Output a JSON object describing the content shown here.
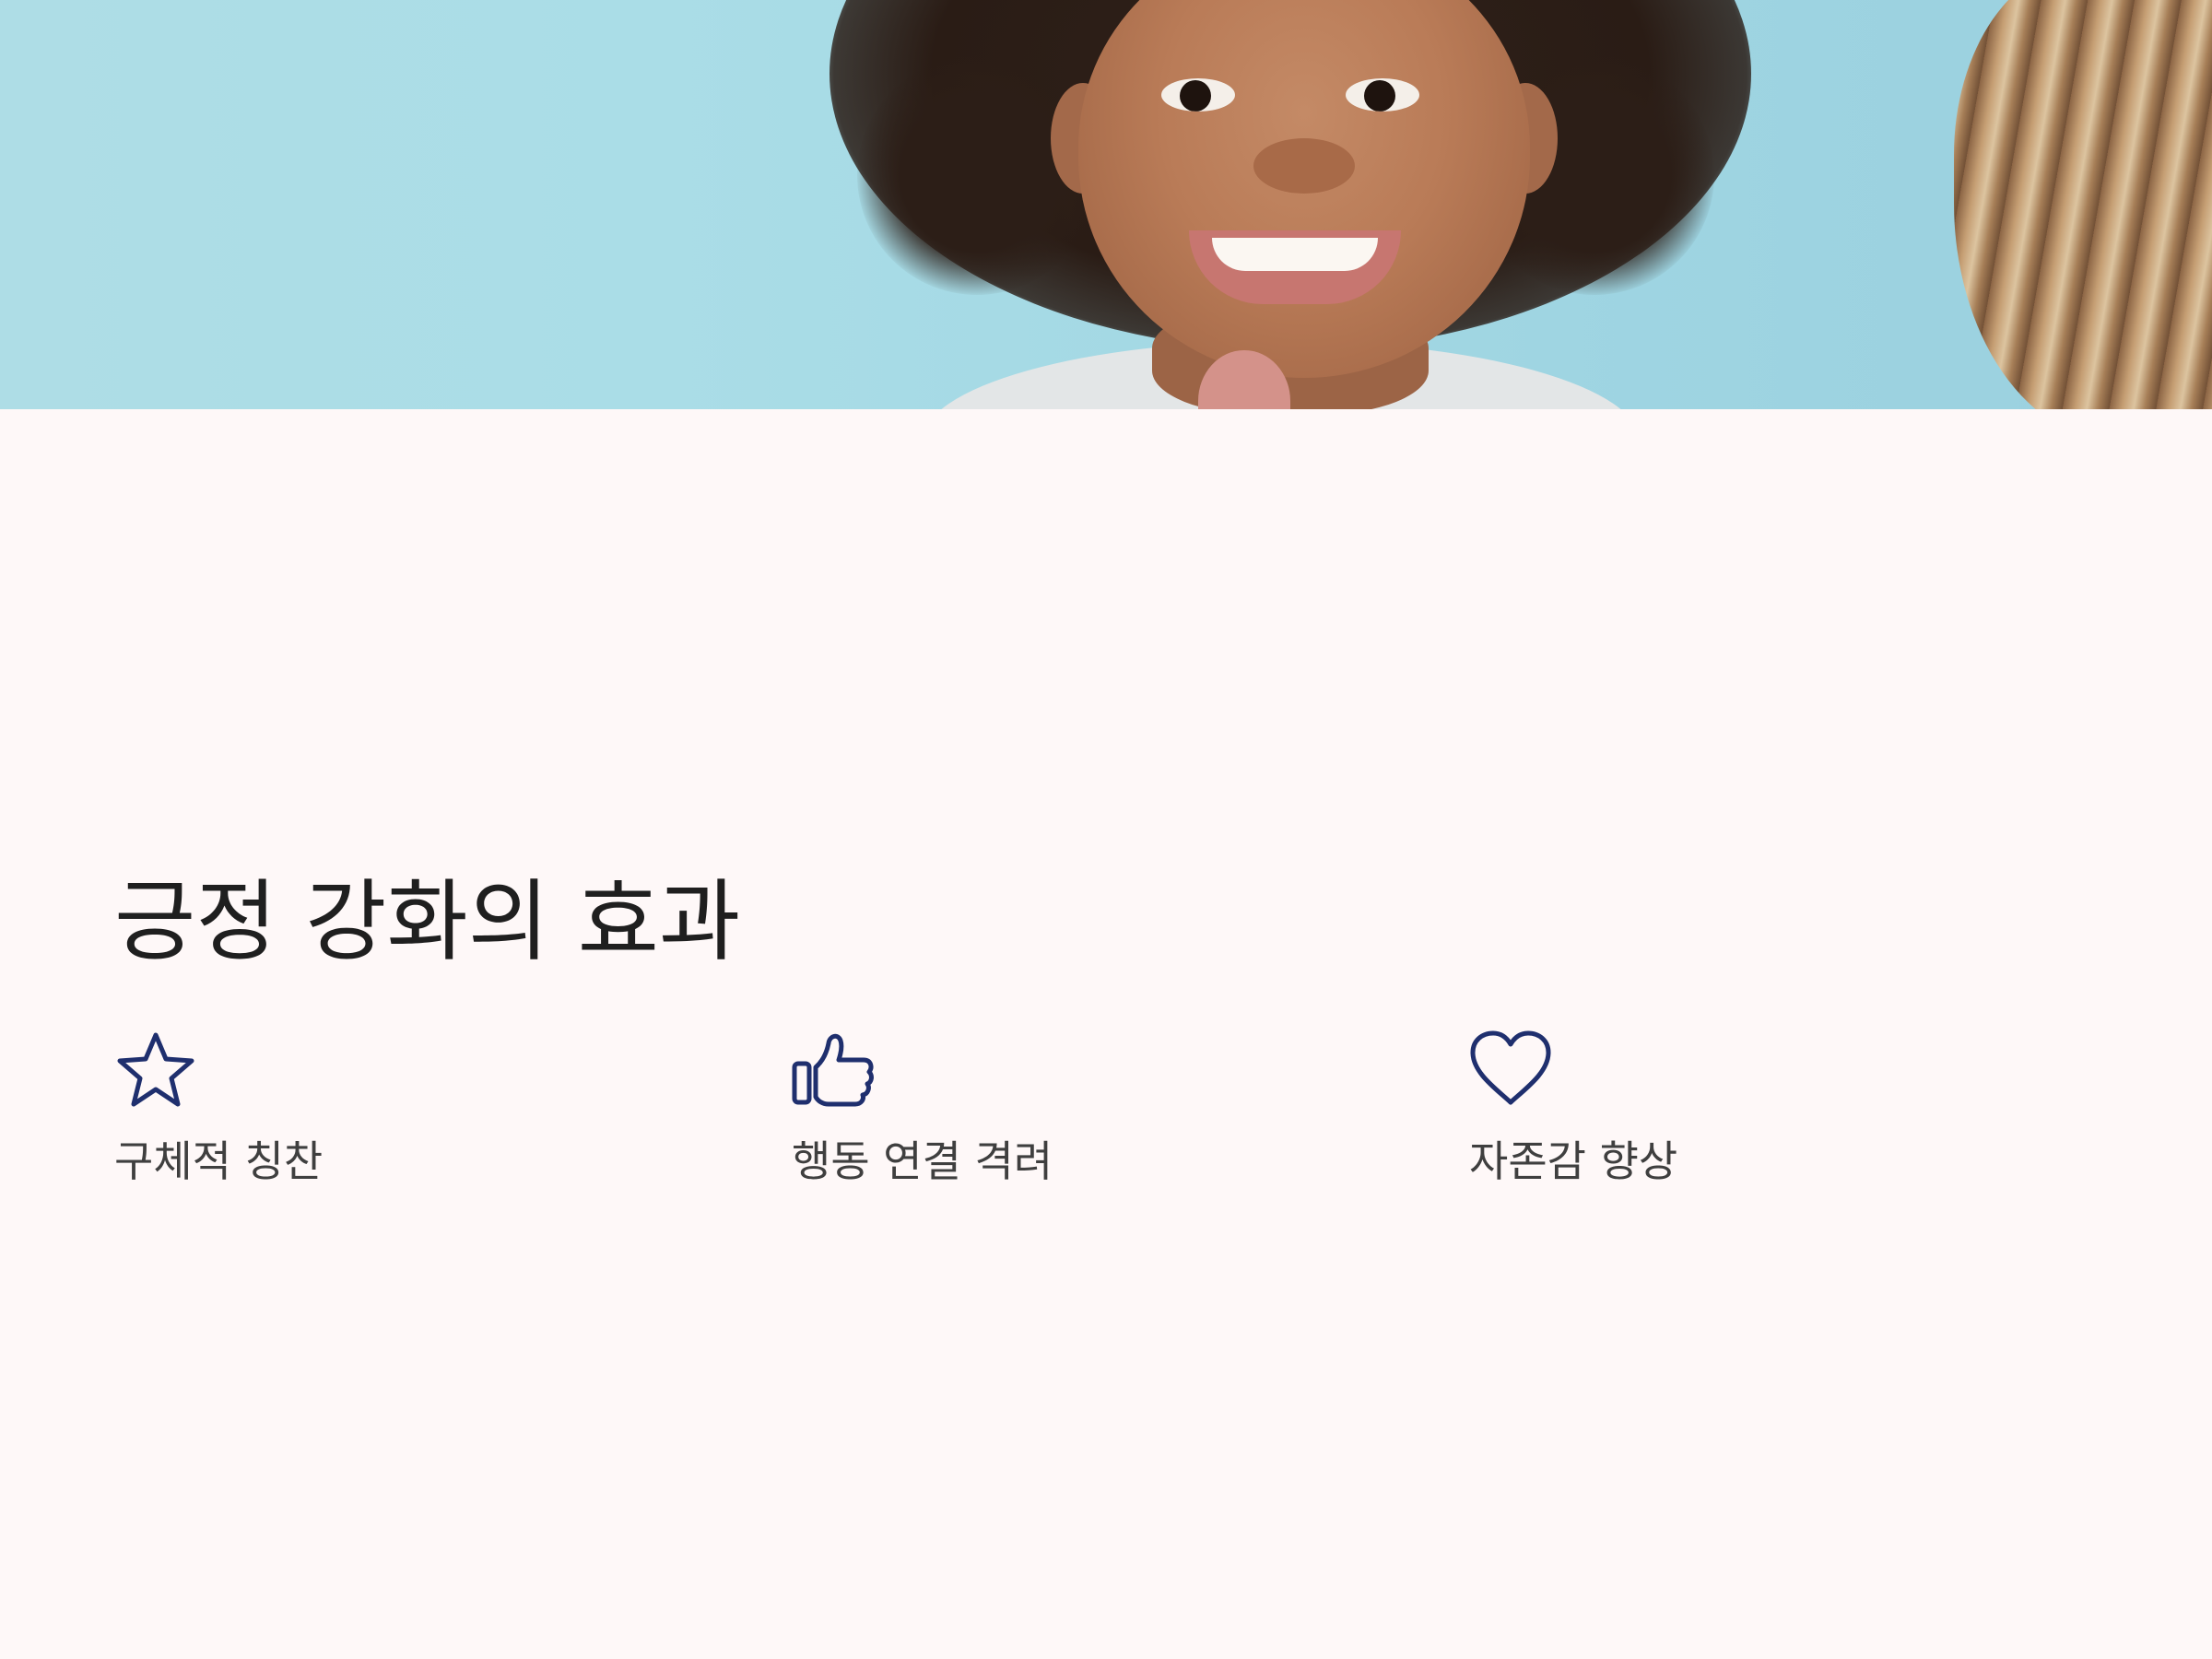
{
  "hero": {
    "image": "smiling-child-photo"
  },
  "section": {
    "title": "긍정 강화의 효과",
    "features": [
      {
        "icon": "star-icon",
        "label": "구체적 칭찬"
      },
      {
        "icon": "thumbs-up-icon",
        "label": "행동 연결 격려"
      },
      {
        "icon": "heart-icon",
        "label": "자존감 향상"
      }
    ]
  },
  "colors": {
    "background": "#fef8f8",
    "icon_stroke": "#1f2f6e",
    "heading_text": "#1f1f1f",
    "label_text": "#3f3f3f"
  }
}
